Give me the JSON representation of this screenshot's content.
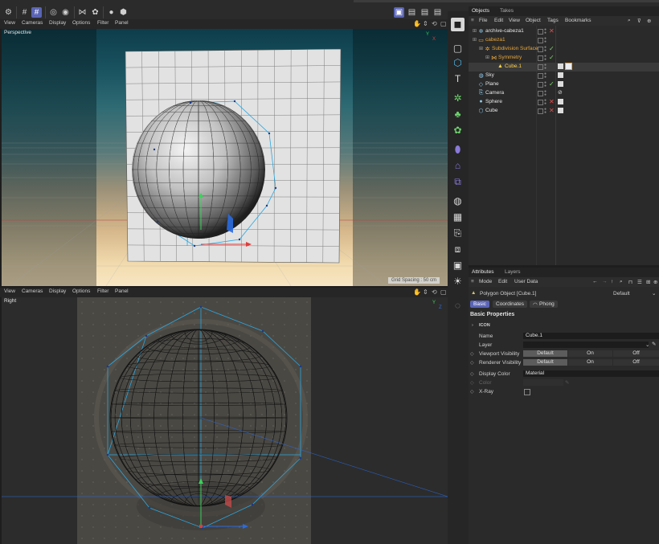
{
  "top_toolbar": {
    "icons": [
      "move-snap-icon",
      "grid-icon",
      "grid-select-icon",
      "record-icon",
      "play-icon",
      "butterfly-icon",
      "settings-icon",
      "dot-icon",
      "box-icon"
    ],
    "right_icons": [
      "layout-icon",
      "film-icon",
      "film2-icon",
      "film3-icon"
    ]
  },
  "viewport_top": {
    "menu": [
      "View",
      "Cameras",
      "Display",
      "Options",
      "Filter",
      "Panel"
    ],
    "label": "Perspective",
    "grid_spacing": "Grid Spacing : 50 cm"
  },
  "viewport_bottom": {
    "menu": [
      "View",
      "Cameras",
      "Display",
      "Options",
      "Filter",
      "Panel"
    ],
    "label": "Right"
  },
  "objects_panel": {
    "tabs": [
      "Objects",
      "Takes"
    ],
    "menu": [
      "File",
      "Edit",
      "View",
      "Object",
      "Tags",
      "Bookmarks"
    ],
    "items": [
      {
        "name": "archive-cabeza1",
        "color": "#e6e6e6",
        "indent": 0,
        "flag": "✕",
        "flag_color": "#e05050"
      },
      {
        "name": "cabeza1",
        "color": "#e8a63a",
        "indent": 0,
        "flag": "",
        "flag_color": "#ccc"
      },
      {
        "name": "Subdivision Surface",
        "color": "#e8a63a",
        "indent": 1,
        "flag": "✓",
        "flag_color": "#7fd36b"
      },
      {
        "name": "Symmetry",
        "color": "#e8a63a",
        "indent": 2,
        "flag": "✓",
        "flag_color": "#7fd36b"
      },
      {
        "name": "Cube.1",
        "color": "#ffd24a",
        "indent": 3,
        "flag": "",
        "flag_color": "#ccc"
      },
      {
        "name": "Sky",
        "color": "#e6e6e6",
        "indent": 0,
        "flag": "",
        "flag_color": "#ccc"
      },
      {
        "name": "Plane",
        "color": "#e6e6e6",
        "indent": 0,
        "flag": "✓",
        "flag_color": "#7fd36b"
      },
      {
        "name": "Camera",
        "color": "#e6e6e6",
        "indent": 0,
        "flag": "",
        "flag_color": "#ccc"
      },
      {
        "name": "Sphere",
        "color": "#e6e6e6",
        "indent": 0,
        "flag": "✕",
        "flag_color": "#e05050"
      },
      {
        "name": "Cube",
        "color": "#e6e6e6",
        "indent": 0,
        "flag": "✕",
        "flag_color": "#e05050"
      }
    ]
  },
  "attributes_panel": {
    "tabs": [
      "Attributes",
      "Layers"
    ],
    "menu": [
      "Mode",
      "Edit",
      "User Data"
    ],
    "object_title": "Polygon Object [Cube.1]",
    "preset": "Default",
    "subtabs": [
      "Basic",
      "Coordinates",
      "Phong"
    ],
    "section_title": "Basic Properties",
    "icon_group": "ICON",
    "fields": {
      "name_label": "Name",
      "name_value": "Cube.1",
      "layer_label": "Layer",
      "layer_value": "",
      "viewport_visibility_label": "Viewport Visibility",
      "renderer_visibility_label": "Renderer Visibility",
      "visibility_options": [
        "Default",
        "On",
        "Off"
      ],
      "display_color_label": "Display Color",
      "display_color_value": "Material",
      "color_label": "Color",
      "xray_label": "X-Ray"
    }
  }
}
